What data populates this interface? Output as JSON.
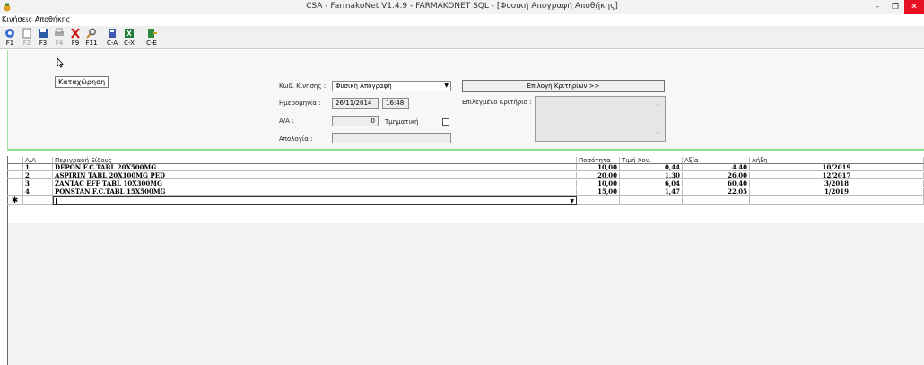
{
  "window": {
    "title": "CSA - FarmakoNet V1.4.9 - FARMAKONET SQL - [Φυσική Απογραφή Αποθήκης]",
    "minimize": "–",
    "restore": "❐",
    "close": "✕"
  },
  "menu": {
    "item": "Κινήσεις Αποθήκης"
  },
  "toolbar": {
    "buttons": [
      {
        "label": "F1",
        "icon": "help-icon"
      },
      {
        "label": "F2",
        "icon": "new-document-icon"
      },
      {
        "label": "F3",
        "icon": "save-icon"
      },
      {
        "label": "F4",
        "icon": "print-icon"
      },
      {
        "label": "F9",
        "icon": "delete-icon"
      },
      {
        "label": "F11",
        "icon": "search-icon"
      },
      {
        "label": "C-A",
        "icon": "notebook-icon"
      },
      {
        "label": "C-X",
        "icon": "excel-icon"
      },
      {
        "label": "C-E",
        "icon": "export-icon"
      }
    ],
    "tooltip": "Καταχώρηση"
  },
  "form": {
    "movement_code_label": "Κωδ. Κίνησης :",
    "movement_code_value": "Φυσική Απογραφή",
    "date_label": "Ημερομηνία :",
    "date_value": "26/11/2014",
    "time_value": "16:48",
    "aa_label": "Α/Α :",
    "aa_value": "0",
    "partial_label": "Τμηματική",
    "reason_label": "Απολογία :",
    "reason_value": "",
    "criteria_button": "Επιλογή Κριτηρίων >>",
    "selected_criteria_label": "Επιλεγμένο Κριτήριο :"
  },
  "grid": {
    "headers": [
      "Α/Α",
      "Περιγραφή Είδους",
      "Ποσότητα",
      "Τιμή Χον.",
      "Αξία",
      "Λήξη"
    ],
    "rows": [
      {
        "aa": "1",
        "description": "DEPON F.C.TABL 20X500MG",
        "quantity": "10,00",
        "price": "0,44",
        "value": "4,40",
        "expiry": "10/2019"
      },
      {
        "aa": "2",
        "description": "ASPIRIN TABL 20X100MG PED",
        "quantity": "20,00",
        "price": "1,30",
        "value": "26,00",
        "expiry": "12/2017"
      },
      {
        "aa": "3",
        "description": "ZANTAC EFF TABL 10X300MG",
        "quantity": "10,00",
        "price": "6,04",
        "value": "60,40",
        "expiry": "3/2018"
      },
      {
        "aa": "4",
        "description": "PONSTAN F.C.TABL 15X500MG",
        "quantity": "15,00",
        "price": "1,47",
        "value": "22,05",
        "expiry": "1/2019"
      }
    ],
    "new_row_marker": "✱"
  }
}
